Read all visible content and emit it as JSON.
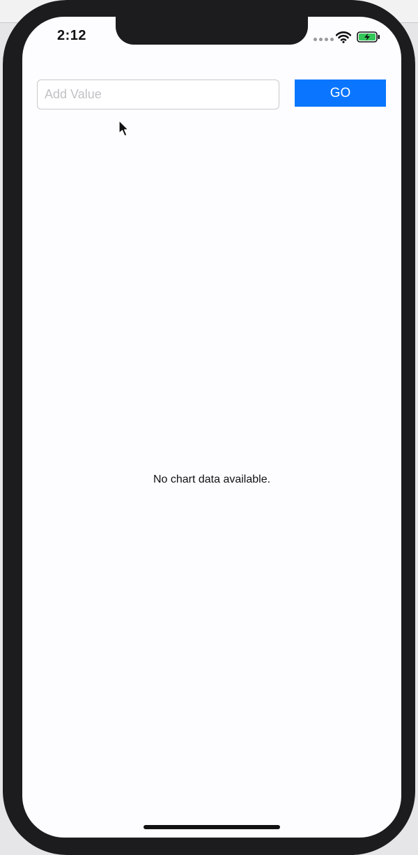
{
  "status_bar": {
    "time": "2:12"
  },
  "form": {
    "input_placeholder": "Add Value",
    "input_value": "",
    "go_label": "GO"
  },
  "chart": {
    "empty_message": "No chart data available."
  },
  "colors": {
    "accent": "#0a76ff",
    "battery_charge": "#34c759",
    "screen_bg": "#fdfcff",
    "frame": "#1c1b1e"
  },
  "icons": {
    "wifi": "wifi-icon",
    "battery": "battery-charging-icon",
    "signal": "cellular-signal-icon",
    "cursor": "mouse-pointer-icon"
  }
}
